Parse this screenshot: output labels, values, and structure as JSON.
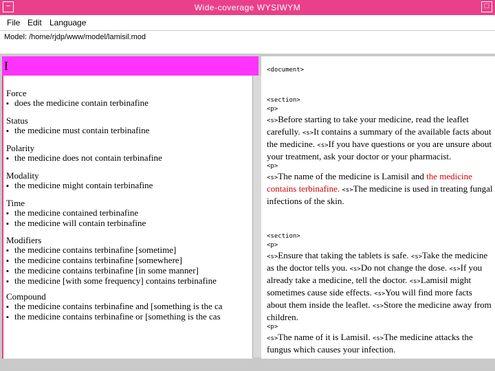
{
  "window": {
    "title": "Wide-coverage WYSIWYM",
    "min_glyph": "−",
    "close_glyph": "□"
  },
  "menu": {
    "items": [
      "File",
      "Edit",
      "Language"
    ]
  },
  "model_path": "Model: /home/rjdp/www/model/lamisil.mod",
  "editor": {
    "caret": "I"
  },
  "groups": [
    {
      "heading": "Force",
      "items": [
        "does the medicine contain terbinafine"
      ]
    },
    {
      "heading": "Status",
      "items": [
        "the medicine must contain terbinafine"
      ]
    },
    {
      "heading": "Polarity",
      "items": [
        "the medicine does not contain terbinafine"
      ]
    },
    {
      "heading": "Modality",
      "items": [
        "the medicine might contain terbinafine"
      ]
    },
    {
      "heading": "Time",
      "items": [
        "the medicine contained terbinafine",
        "the medicine will contain terbinafine"
      ]
    },
    {
      "heading": "Modifiers",
      "items": [
        "the medicine contains terbinafine [sometime]",
        "the medicine contains terbinafine [somewhere]",
        "the medicine contains terbinafine [in some manner]",
        "the medicine [with some frequency] contains terbinafine"
      ]
    },
    {
      "heading": "Compound",
      "items": [
        "the medicine contains terbinafine and [something is the ca",
        "the medicine contains terbinafine or [something is the cas"
      ]
    }
  ],
  "xml": {
    "document_tag": "<document>",
    "section_tag": "<section>",
    "p_tag": "<p>",
    "s_tag": "<s>",
    "s1": {
      "p1": [
        "Before starting to take your medicine, read the leaflet carefully.",
        "It contains a summary of the available facts about the medicine.",
        "If you have questions or you are unsure about your treatment, ask your doctor or your pharmacist."
      ],
      "p2_a": "The name of the medicine is Lamisil and ",
      "p2_hl": "the medicine contains terbinafine.",
      "p2_b": "The medicine is used in treating fungal infections of the skin."
    },
    "s2": {
      "p1": [
        "Ensure that taking the tablets is safe.",
        "Take the medicine as the doctor tells you.",
        "Do not change the dose.",
        "If you already take a medicine, tell the doctor.",
        "Lamisil might sometimes cause side effects.",
        "You will find more facts about them inside the leaflet.",
        "Store the medicine away from children."
      ],
      "p2": [
        "The name of it is Lamisil.",
        "The medicine attacks the fungus which causes your infection."
      ]
    }
  },
  "colors": {
    "titlebar": "#ea3f8a",
    "edit_highlight": "#ff33ff",
    "highlight_text": "#cc0000"
  }
}
